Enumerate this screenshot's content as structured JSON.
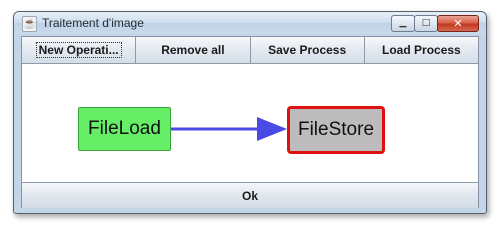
{
  "window": {
    "title": "Traitement d'image",
    "app_icon_glyph": "☕",
    "controls": {
      "minimize_glyph": "▁",
      "maximize_glyph": "□",
      "close_glyph": "✕"
    }
  },
  "toolbar": {
    "buttons": [
      {
        "label": "New Operati..."
      },
      {
        "label": "Remove all"
      },
      {
        "label": "Save Process"
      },
      {
        "label": "Load Process"
      }
    ]
  },
  "graph": {
    "nodes": [
      {
        "label": "FileLoad",
        "fill": "#66ee66",
        "border": "#3aa43a",
        "selected": false
      },
      {
        "label": "FileStore",
        "fill": "#bcbcbc",
        "border": "#e01010",
        "selected": true
      }
    ],
    "edges": [
      {
        "from": "FileLoad",
        "to": "FileStore",
        "color": "#4a4ae6"
      }
    ]
  },
  "footer": {
    "ok_label": "Ok"
  },
  "colors": {
    "accent": "#4a4ae6",
    "selection": "#e01010"
  }
}
